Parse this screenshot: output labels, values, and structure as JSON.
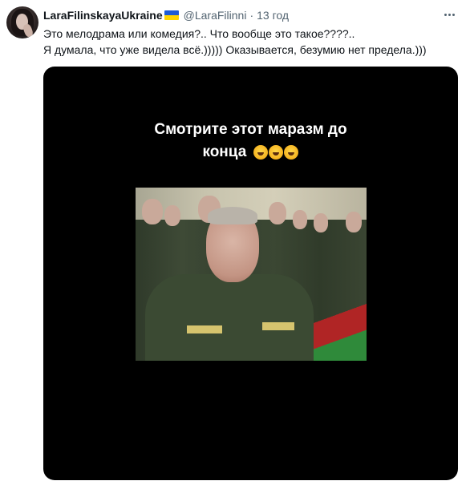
{
  "tweet": {
    "author_name": "LaraFilinskayaUkraine",
    "flag_icon": "ukraine-flag-icon",
    "handle": "@LaraFilinni",
    "separator": "·",
    "time": "13 год",
    "more_icon": "more-horizontal-icon",
    "text_lines": [
      "Это мелодрама или комедия?.. Что вообще это такое????..",
      "Я думала, что уже видела всё.))))) Оказывается, безумию нет предела.)))"
    ]
  },
  "media": {
    "caption_line1": "Смотрите этот маразм до",
    "caption_line2": "конца",
    "caption_emoji_icon": "rolling-on-floor-laughing-emoji"
  },
  "colors": {
    "text_primary": "#0f1419",
    "text_secondary": "#536471",
    "media_background": "#000000"
  }
}
